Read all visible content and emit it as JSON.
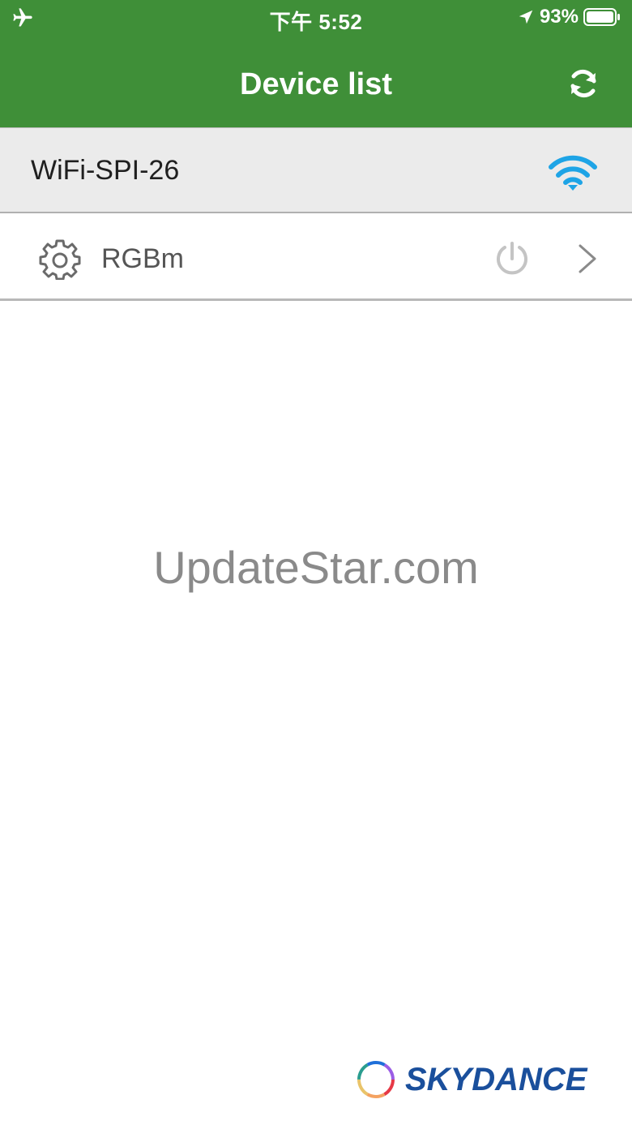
{
  "status_bar": {
    "time": "下午 5:52",
    "battery_percent": "93%",
    "icons": [
      "airplane-icon",
      "location-arrow-icon",
      "battery-icon"
    ]
  },
  "header": {
    "title": "Device list",
    "refresh_icon": "refresh-icon",
    "background_color": "#3f8f38"
  },
  "network": {
    "ssid": "WiFi-SPI-26",
    "icon": "wifi-icon",
    "icon_color": "#1ea4e6"
  },
  "devices": [
    {
      "name": "RGBm",
      "settings_icon": "gear-icon",
      "power_icon": "power-icon",
      "nav_icon": "chevron-right-icon"
    }
  ],
  "watermark": "UpdateStar.com",
  "brand": {
    "name": "SKYDANCE",
    "color": "#1a4f9c"
  }
}
